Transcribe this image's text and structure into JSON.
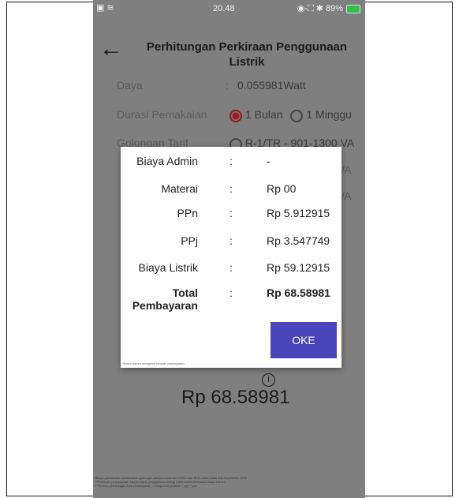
{
  "status_bar": {
    "left": "▣ ≋",
    "time": "20.48",
    "right": "◉-⛶ ✱ 89%"
  },
  "header": {
    "back_symbol": "←",
    "title": "Perhitungan Perkiraan Penggunaan Listrik"
  },
  "form": {
    "daya_label": "Daya",
    "daya_value": "0.055981Watt",
    "durasi_label": "Durasi Pemakaian",
    "durasi_options": [
      "1 Bulan",
      "1 Minggu"
    ],
    "durasi_selected": "1 Bulan",
    "golongan_label": "Golongan Tarif",
    "golongan_value": "R-1/TR - 901-1300 VA",
    "partial_vals": [
      "VA",
      "VA"
    ],
    "separator": ":"
  },
  "dialog": {
    "rows": [
      {
        "label": "Biaya Admin",
        "value": "-"
      },
      {
        "label": "Materai",
        "value": "Rp 00"
      },
      {
        "label": "PPn",
        "value": "Rp 5.912915"
      },
      {
        "label": "PPj",
        "value": "Rp 3.547749"
      },
      {
        "label": "Biaya Listrik",
        "value": "Rp 59.12915"
      }
    ],
    "total_label_line1": "Total",
    "total_label_line2": "Pembayaran",
    "total_value": "Rp 68.58981",
    "ok_button": "OKE",
    "note": "*Biaya Admin mengikuti tempat pembayaran"
  },
  "result": {
    "total": "Rp 68.58981",
    "info_icon": "info-icon"
  },
  "footnote": {
    "lines": [
      "*Biaya pemakaian berdasarkan golongan dan kementerian ESDM dan PLN untuk bulan Juli-September 2020",
      "**Perkiraan pembayaran hanya untuk penggunaan energi listrik belum termasuk biaya Admin",
      "***Rumus perhitungan total pembayaran = harga energi listrik + ppj + ppn"
    ]
  }
}
